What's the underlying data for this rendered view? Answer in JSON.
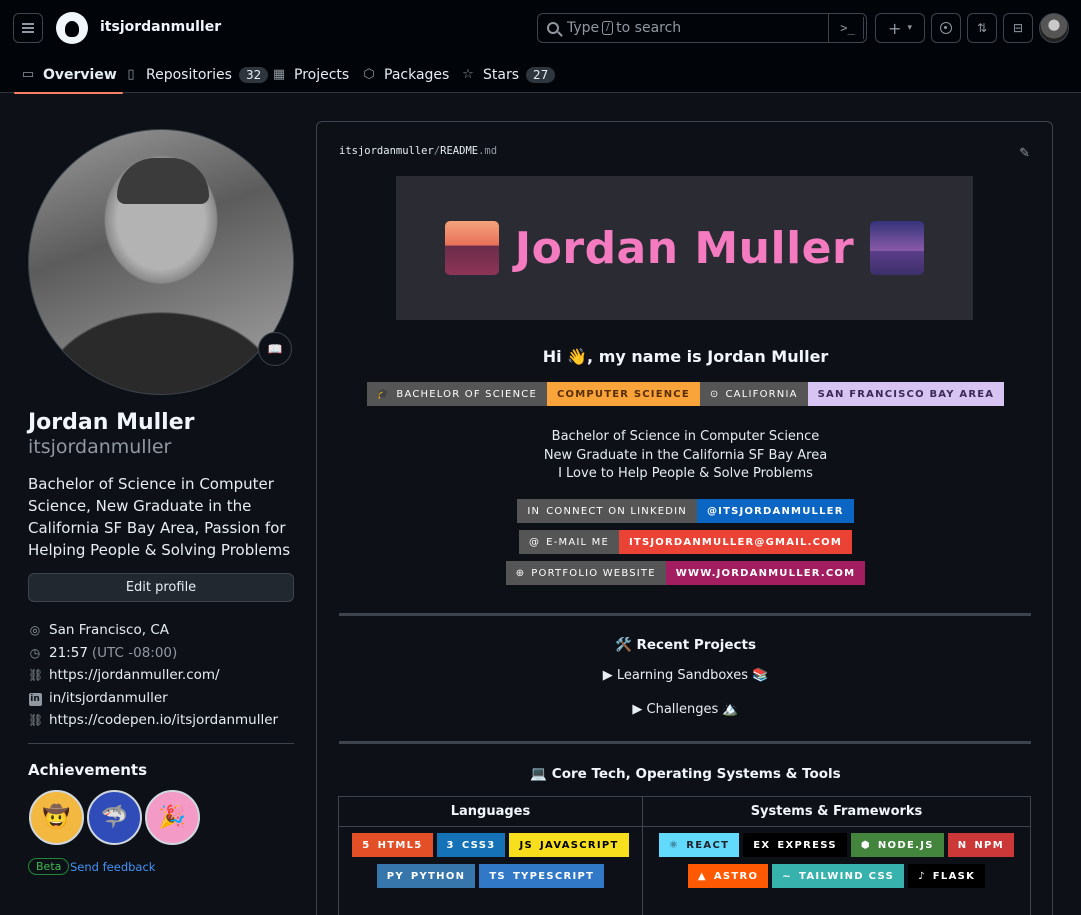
{
  "header": {
    "username": "itsjordanmuller",
    "search_pre": "Type",
    "search_key": "/",
    "search_post": "to search",
    "cmd": ">_",
    "plus": "+",
    "tabs": [
      {
        "label": "Overview",
        "icon": "book-icon"
      },
      {
        "label": "Repositories",
        "count": "32",
        "icon": "repo-icon"
      },
      {
        "label": "Projects",
        "icon": "table-icon"
      },
      {
        "label": "Packages",
        "icon": "package-icon"
      },
      {
        "label": "Stars",
        "count": "27",
        "icon": "star-icon"
      }
    ]
  },
  "profile": {
    "status_emoji": "📖",
    "name": "Jordan Muller",
    "login": "itsjordanmuller",
    "bio": "Bachelor of Science in Computer Science, New Graduate in the California SF Bay Area, Passion for Helping People & Solving Problems",
    "edit_label": "Edit profile",
    "location": "San Francisco, CA",
    "time": "21:57",
    "timezone": "(UTC -08:00)",
    "website": "https://jordanmuller.com/",
    "linkedin": "in/itsjordanmuller",
    "codepen": "https://codepen.io/itsjordanmuller",
    "achievements_title": "Achievements",
    "achievements": [
      "🤠",
      "🦈",
      "🎉"
    ],
    "beta": "Beta",
    "feedback": "Send feedback"
  },
  "readme": {
    "owner": "itsjordanmuller",
    "sep": "/",
    "file": "README",
    "ext": ".md",
    "banner_title": "Jordan Muller",
    "hi": "Hi 👋, my name is Jordan Muller",
    "edu_badges": [
      {
        "icon": "🎓",
        "label": "Bachelor of Science",
        "value": "Computer Science",
        "color": "#f9a43a",
        "text": "#5a2d00"
      },
      {
        "icon": "⊙",
        "label": "California",
        "value": "San Francisco Bay Area",
        "color": "#d7c4f2",
        "text": "#3a2a56"
      }
    ],
    "intro": [
      "Bachelor of Science in Computer Science",
      "New Graduate in the California SF Bay Area",
      "I Love to Help People & Solve Problems"
    ],
    "contact_badges": [
      {
        "icon": "in",
        "label": "Connect on LinkedIn",
        "value": "@itsjordanmuller",
        "color": "#0a66c2"
      },
      {
        "icon": "@",
        "label": "E-mail Me",
        "value": "itsjordanmuller@gmail.com",
        "color": "#ea4335"
      },
      {
        "icon": "⊕",
        "label": "Portfolio Website",
        "value": "www.jordanmuller.com",
        "color": "#a31e60"
      }
    ],
    "recent_title": "🛠️ Recent Projects",
    "sandboxes": "▶ Learning Sandboxes 📚",
    "challenges": "▶ Challenges 🏔️",
    "tech_title": "💻 Core Tech, Operating Systems & Tools",
    "languages_header": "Languages",
    "systems_header": "Systems & Frameworks",
    "languages": [
      [
        {
          "label": "HTML5",
          "icon": "5",
          "color": "#e34f26"
        },
        {
          "label": "CSS3",
          "icon": "3",
          "color": "#1572b6"
        },
        {
          "label": "JavaScript",
          "icon": "JS",
          "color": "#f7df1e",
          "text": "#000"
        }
      ],
      [
        {
          "label": "Python",
          "icon": "Py",
          "color": "#3776ab"
        },
        {
          "label": "TypeScript",
          "icon": "TS",
          "color": "#3178c6"
        }
      ]
    ],
    "systems": [
      [
        {
          "label": "React",
          "icon": "⚛",
          "color": "#61dafb",
          "text": "#20232a"
        },
        {
          "label": "Express",
          "icon": "ex",
          "color": "#000000"
        },
        {
          "label": "Node.js",
          "icon": "⬢",
          "color": "#43853d"
        },
        {
          "label": "NPM",
          "icon": "n",
          "color": "#cb3837"
        }
      ],
      [
        {
          "label": "Astro",
          "icon": "▲",
          "color": "#ff5a03"
        },
        {
          "label": "Tailwind CSS",
          "icon": "~",
          "color": "#38b2ac"
        },
        {
          "label": "Flask",
          "icon": "♪",
          "color": "#000000"
        }
      ]
    ]
  }
}
